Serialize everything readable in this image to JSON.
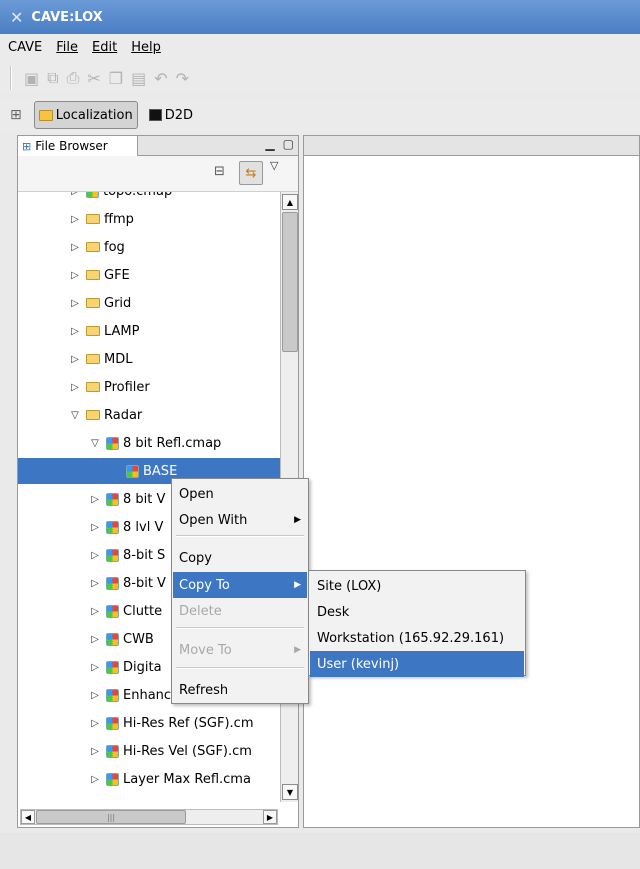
{
  "window": {
    "title": "CAVE:LOX"
  },
  "menubar": {
    "items": [
      "CAVE",
      "File",
      "Edit",
      "Help"
    ]
  },
  "toolbar": {
    "icons": [
      "save-icon",
      "save-all-icon",
      "print-icon",
      "cut-icon",
      "copy-icon",
      "paste-icon",
      "undo-icon",
      "redo-icon"
    ]
  },
  "perspective": {
    "localization": "Localization",
    "d2d": "D2D"
  },
  "file_browser": {
    "tab_label": "File Browser",
    "tree": [
      {
        "label": "topo.cmap",
        "type": "file",
        "indent": 0,
        "state": "collapsed"
      },
      {
        "label": "ffmp",
        "type": "folder",
        "indent": 0,
        "state": "collapsed"
      },
      {
        "label": "fog",
        "type": "folder",
        "indent": 0,
        "state": "collapsed"
      },
      {
        "label": "GFE",
        "type": "folder",
        "indent": 0,
        "state": "collapsed"
      },
      {
        "label": "Grid",
        "type": "folder",
        "indent": 0,
        "state": "collapsed"
      },
      {
        "label": "LAMP",
        "type": "folder",
        "indent": 0,
        "state": "collapsed"
      },
      {
        "label": "MDL",
        "type": "folder",
        "indent": 0,
        "state": "collapsed"
      },
      {
        "label": "Profiler",
        "type": "folder",
        "indent": 0,
        "state": "collapsed"
      },
      {
        "label": "Radar",
        "type": "folder",
        "indent": 0,
        "state": "expanded"
      },
      {
        "label": "8 bit Refl.cmap",
        "type": "file",
        "indent": 1,
        "state": "expanded"
      },
      {
        "label": "BASE",
        "type": "file",
        "indent": 2,
        "state": "leaf",
        "selected": true
      },
      {
        "label": "8 bit V",
        "type": "file",
        "indent": 1,
        "state": "collapsed"
      },
      {
        "label": "8 lvl V",
        "type": "file",
        "indent": 1,
        "state": "collapsed"
      },
      {
        "label": "8-bit S",
        "type": "file",
        "indent": 1,
        "state": "collapsed"
      },
      {
        "label": "8-bit V",
        "type": "file",
        "indent": 1,
        "state": "collapsed"
      },
      {
        "label": "Clutte",
        "type": "file",
        "indent": 1,
        "state": "collapsed"
      },
      {
        "label": "CWB",
        "type": "file",
        "indent": 1,
        "state": "collapsed"
      },
      {
        "label": "Digita",
        "type": "file",
        "indent": 1,
        "state": "collapsed"
      },
      {
        "label": "Enhanced Echo Tops",
        "type": "file",
        "indent": 1,
        "state": "collapsed"
      },
      {
        "label": "Hi-Res Ref (SGF).cm",
        "type": "file",
        "indent": 1,
        "state": "collapsed"
      },
      {
        "label": "Hi-Res Vel (SGF).cm",
        "type": "file",
        "indent": 1,
        "state": "collapsed"
      },
      {
        "label": "Layer Max Refl.cma",
        "type": "file",
        "indent": 1,
        "state": "collapsed"
      }
    ]
  },
  "context_menu": {
    "items": [
      {
        "label": "Open",
        "enabled": true
      },
      {
        "label": "Open With",
        "enabled": true,
        "submenu": true
      },
      {
        "label": "Copy",
        "enabled": true
      },
      {
        "label": "Copy To",
        "enabled": true,
        "submenu": true,
        "highlighted": true
      },
      {
        "label": "Delete",
        "enabled": false
      },
      {
        "label": "Move To",
        "enabled": false,
        "submenu": true
      },
      {
        "label": "Refresh",
        "enabled": true
      }
    ]
  },
  "copy_to_submenu": {
    "items": [
      {
        "label": "Site (LOX)"
      },
      {
        "label": "Desk"
      },
      {
        "label": "Workstation (165.92.29.161)"
      },
      {
        "label": "User (kevinj)",
        "highlighted": true
      }
    ]
  },
  "colors": {
    "selection": "#3d77c4",
    "titlebar": "#4a7fc4"
  }
}
